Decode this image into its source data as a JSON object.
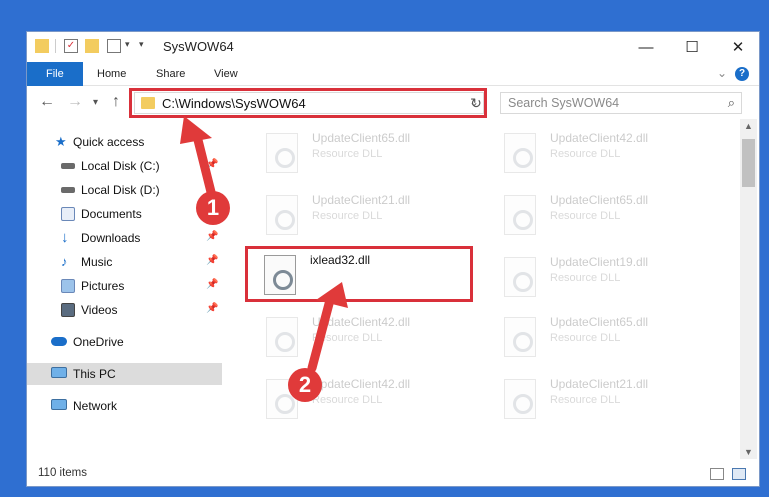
{
  "window": {
    "title": "SysWOW64",
    "controls": {
      "minimize": "—",
      "maximize": "☐",
      "close": "✕"
    }
  },
  "ribbon": {
    "tabs": [
      {
        "label": "File"
      },
      {
        "label": "Home"
      },
      {
        "label": "Share"
      },
      {
        "label": "View"
      }
    ],
    "help_icon": "?"
  },
  "address": {
    "path": "C:\\Windows\\SysWOW64",
    "search_placeholder": "Search SysWOW64"
  },
  "navpane": {
    "items": [
      {
        "label": "Quick access",
        "icon": "star-icon",
        "pinned": false
      },
      {
        "label": "Local Disk (C:)",
        "icon": "drive-icon",
        "pinned": true
      },
      {
        "label": "Local Disk (D:)",
        "icon": "drive-icon",
        "pinned": false
      },
      {
        "label": "Documents",
        "icon": "documents-icon",
        "pinned": true
      },
      {
        "label": "Downloads",
        "icon": "download-icon",
        "pinned": true
      },
      {
        "label": "Music",
        "icon": "music-icon",
        "pinned": true
      },
      {
        "label": "Pictures",
        "icon": "pictures-icon",
        "pinned": true
      },
      {
        "label": "Videos",
        "icon": "videos-icon",
        "pinned": true
      },
      {
        "label": "OneDrive",
        "icon": "cloud-icon",
        "pinned": false
      },
      {
        "label": "This PC",
        "icon": "computer-icon",
        "pinned": false,
        "selected": true
      },
      {
        "label": "Network",
        "icon": "network-icon",
        "pinned": false
      }
    ]
  },
  "files": {
    "faded": [
      {
        "name": "UpdateClient65.dll",
        "desc": "Resource DLL"
      },
      {
        "name": "UpdateClient42.dll",
        "desc": "Resource DLL"
      },
      {
        "name": "UpdateClient21.dll",
        "desc": "Resource DLL"
      },
      {
        "name": "UpdateClient65.dll",
        "desc": "Resource DLL"
      },
      {
        "name": "UpdateClient19.dll",
        "desc": "Resource DLL"
      },
      {
        "name": "UpdateClient42.dll",
        "desc": "Resource DLL"
      },
      {
        "name": "UpdateClient65.dll",
        "desc": "Resource DLL"
      },
      {
        "name": "UpdateClient42.dll",
        "desc": "Resource DLL"
      },
      {
        "name": "UpdateClient21.dll",
        "desc": "Resource DLL"
      }
    ],
    "highlighted": {
      "name": "ixlead32.dll"
    }
  },
  "status": {
    "count": "110 items"
  },
  "annotations": {
    "step1": "1",
    "step2": "2"
  },
  "colors": {
    "accent": "#1a6ec9",
    "highlight": "#d9303a",
    "desktop": "#2f6fd1"
  }
}
